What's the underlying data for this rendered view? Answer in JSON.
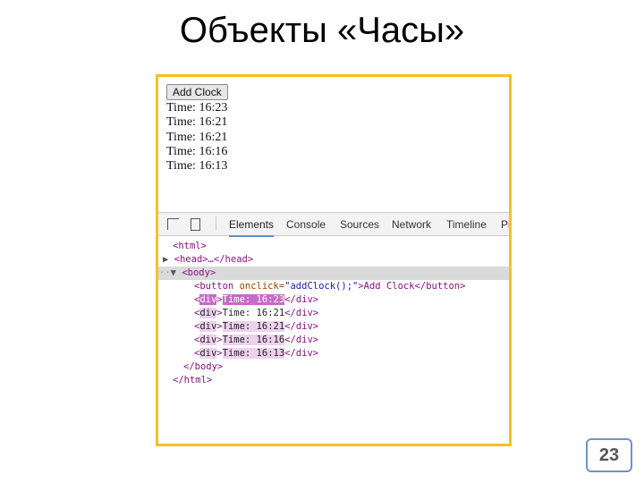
{
  "slide_title": "Объекты «Часы»",
  "page_number": "23",
  "browser": {
    "add_button": "Add Clock",
    "times": [
      "Time: 16:23",
      "Time: 16:21",
      "Time: 16:21",
      "Time: 16:16",
      "Time: 16:13"
    ]
  },
  "devtools": {
    "tabs": [
      "Elements",
      "Console",
      "Sources",
      "Network",
      "Timeline",
      "Pr"
    ],
    "active_tab": "Elements",
    "code": {
      "html_open": "<html>",
      "head": "<head>…</head>",
      "body_open": "<body>",
      "button_open": "<button ",
      "button_attr": "onclick=",
      "button_val": "\"addClock();\"",
      "button_text": ">Add Clock</button>",
      "div": "div",
      "div_texts": [
        "Time: 16:23",
        "Time: 16:21",
        "Time: 16:21",
        "Time: 16:16",
        "Time: 16:13"
      ],
      "div_close": "</div>",
      "body_close": "</body>",
      "html_close": "</html>"
    }
  },
  "colors": {
    "frame": "#f5c024",
    "highlight": "#c66bc6",
    "page_box": "#6f93c8"
  }
}
